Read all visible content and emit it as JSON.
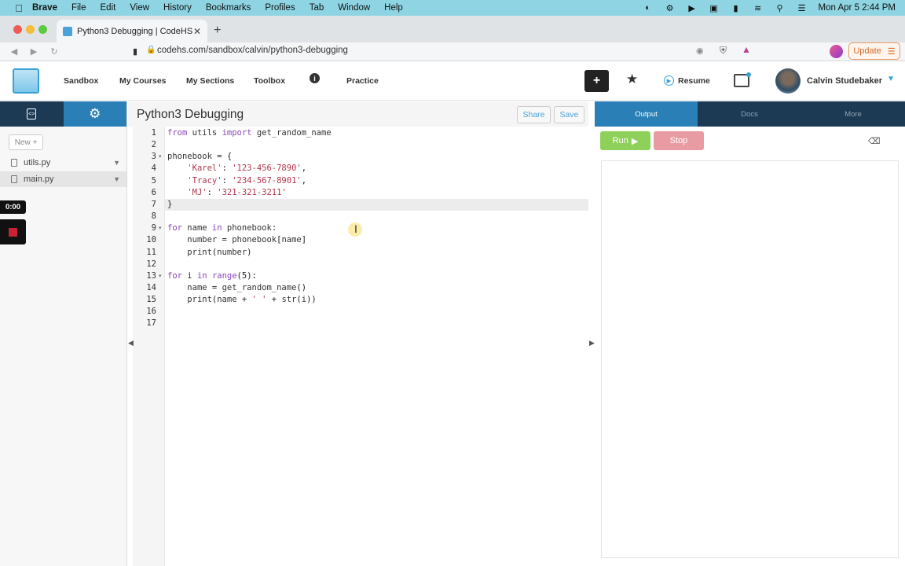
{
  "menubar": {
    "app": "Brave",
    "items": [
      "File",
      "Edit",
      "View",
      "History",
      "Bookmarks",
      "Profiles",
      "Tab",
      "Window",
      "Help"
    ],
    "clock": "Mon Apr 5  2:44 PM",
    "bg_color": "#8ed4e2"
  },
  "browser": {
    "tab_title": "Python3 Debugging | CodeHS",
    "url": "codehs.com/sandbox/calvin/python3-debugging",
    "update_label": "Update"
  },
  "header": {
    "nav": [
      "Sandbox",
      "My Courses",
      "My Sections",
      "Toolbox",
      "Practice"
    ],
    "resume_label": "Resume",
    "user_name": "Calvin Studebaker"
  },
  "sidebar": {
    "new_label": "New +",
    "files": [
      "utils.py",
      "main.py"
    ],
    "selected_file": "main.py",
    "timer": "0:00"
  },
  "editor": {
    "title": "Python3 Debugging",
    "share_label": "Share",
    "save_label": "Save",
    "active_line": 7,
    "lines": [
      "from utils import get_random_name",
      "",
      "phonebook = {",
      "    'Karel': '123-456-7890',",
      "    'Tracy': '234-567-8901',",
      "    'MJ': '321-321-3211'",
      "}",
      "",
      "for name in phonebook:",
      "    number = phonebook[name]",
      "    print(number)",
      "",
      "for i in range(5):",
      "    name = get_random_name()",
      "    print(name + ' ' + str(i))",
      "",
      ""
    ]
  },
  "output": {
    "tabs": [
      "Output",
      "Docs",
      "More"
    ],
    "active_tab": "Output",
    "run_label": "Run",
    "stop_label": "Stop",
    "colors": {
      "run": "#8fd05a",
      "stop": "#e99ba3",
      "accent": "#2a7fb7",
      "dark": "#1d3a55"
    }
  }
}
